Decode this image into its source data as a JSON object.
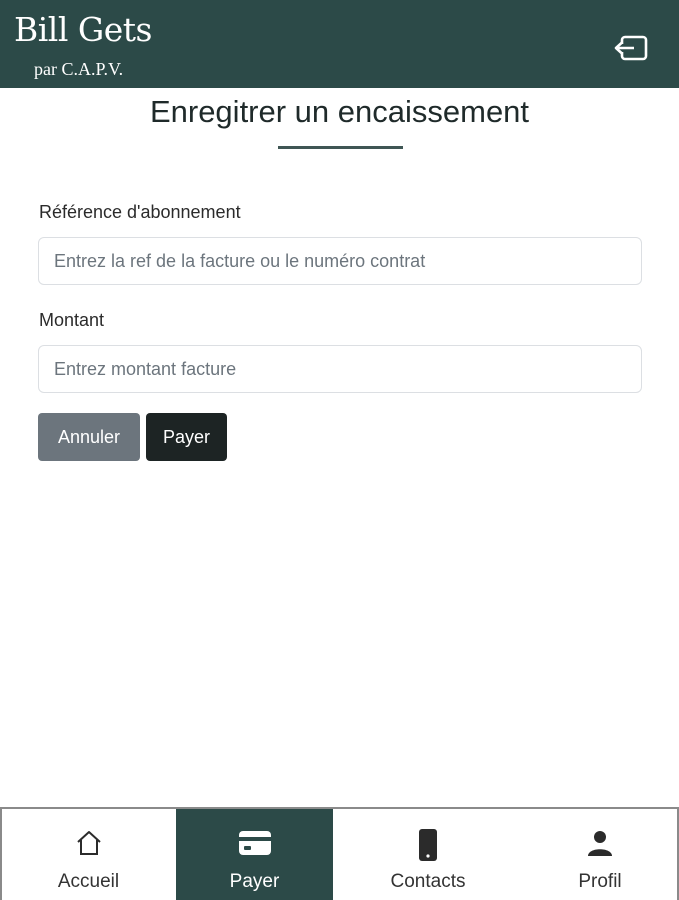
{
  "header": {
    "title": "Bill Gets",
    "subtitle": "par C.A.P.V.",
    "logout_icon": "logout-icon",
    "bg_color": "#2c4a48"
  },
  "page": {
    "title": "Enregitrer un encaissement"
  },
  "form": {
    "reference": {
      "label": "Référence d'abonnement",
      "placeholder": "Entrez la ref de la facture ou le numéro contrat",
      "value": ""
    },
    "amount": {
      "label": "Montant",
      "placeholder": "Entrez montant facture",
      "value": ""
    },
    "buttons": {
      "cancel": "Annuler",
      "pay": "Payer"
    }
  },
  "nav": {
    "items": [
      {
        "label": "Accueil",
        "icon": "home-icon",
        "active": false
      },
      {
        "label": "Payer",
        "icon": "credit-card-icon",
        "active": true
      },
      {
        "label": "Contacts",
        "icon": "phone-icon",
        "active": false
      },
      {
        "label": "Profil",
        "icon": "person-icon",
        "active": false
      }
    ]
  }
}
